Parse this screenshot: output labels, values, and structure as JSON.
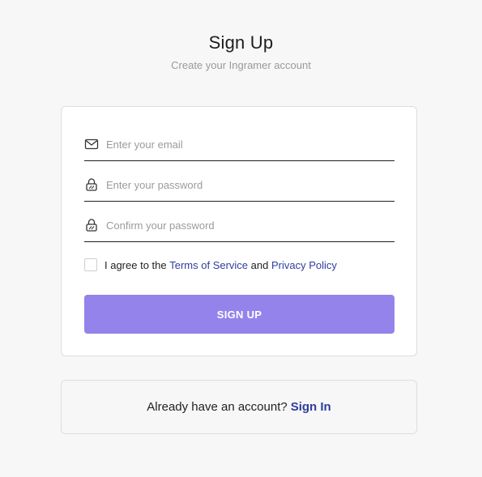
{
  "header": {
    "title": "Sign Up",
    "subtitle": "Create your Ingramer account"
  },
  "form": {
    "email": {
      "placeholder": "Enter your email",
      "value": "",
      "icon": "mail-icon"
    },
    "password": {
      "placeholder": "Enter your password",
      "value": "",
      "icon": "lock-icon"
    },
    "confirm_password": {
      "placeholder": "Confirm your password",
      "value": "",
      "icon": "lock-icon"
    },
    "agree": {
      "prefix": "I agree to the ",
      "terms_link": "Terms of Service",
      "middle": " and ",
      "privacy_link": "Privacy Policy",
      "checked": false
    },
    "submit_label": "SIGN UP"
  },
  "signin": {
    "prompt": "Already have an account?",
    "link": "Sign In"
  },
  "colors": {
    "background": "#f7f7f7",
    "button": "#9483ea",
    "link": "#2f3e9e"
  }
}
